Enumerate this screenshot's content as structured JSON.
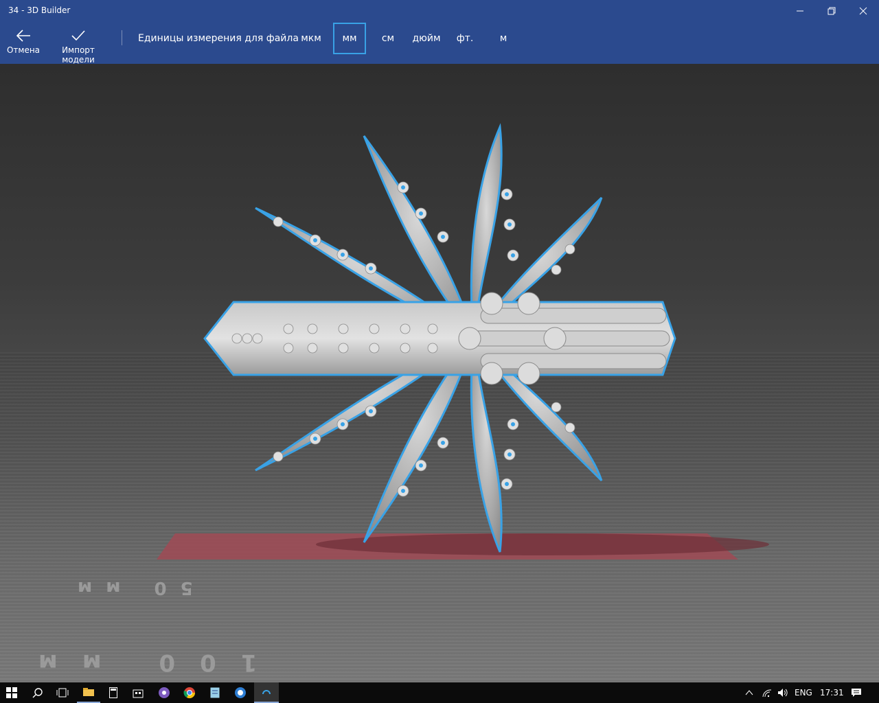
{
  "window": {
    "title": "34 - 3D Builder"
  },
  "toolbar": {
    "cancel_label": "Отмена",
    "import_label": "Импорт модели",
    "units_label": "Единицы измерения для файла",
    "units": [
      "мкм",
      "мм",
      "см",
      "дюйм",
      "фт.",
      "м"
    ],
    "selected_unit": "мм"
  },
  "viewport": {
    "bed_label": "50 мм",
    "floor_label": "100 мм",
    "selection_color": "#39a2e6",
    "bed_color": "#a04a55"
  },
  "taskbar": {
    "language": "ENG",
    "time": "17:31",
    "icons": [
      "start-icon",
      "search-icon",
      "task-view-icon",
      "file-explorer-icon",
      "calculator-icon",
      "store-icon",
      "viber-icon",
      "chrome-icon",
      "notepad-icon",
      "app-icon",
      "3d-builder-icon"
    ]
  },
  "colors": {
    "accent": "#2b4a8e",
    "taskbar": "#0b0b0b"
  }
}
